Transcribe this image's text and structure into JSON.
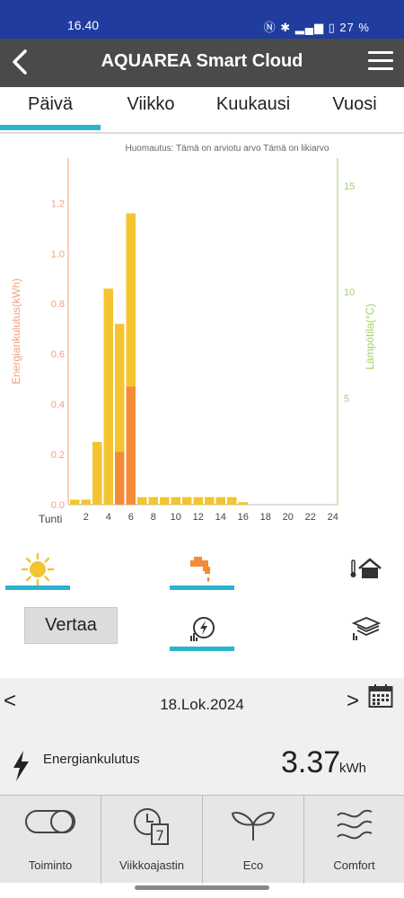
{
  "status": {
    "time": "16.40",
    "battery": "27 %"
  },
  "appbar": {
    "title": "AQUAREA Smart Cloud"
  },
  "tabs": [
    {
      "label": "Päivä"
    },
    {
      "label": "Viikko"
    },
    {
      "label": "Kuukausi"
    },
    {
      "label": "Vuosi"
    }
  ],
  "chart_data": {
    "type": "bar",
    "note": "Huomautus: Tämä on arviotu arvo Tämä on likiarvo",
    "ylabel": "Energiankulutus(kWh)",
    "y2label": "Lämpötila(°C)",
    "xlabel": "Tunti",
    "ylim": [
      0,
      1.2
    ],
    "y2lim": [
      0,
      15
    ],
    "yticks": [
      "0.0",
      "0.2",
      "0.4",
      "0.6",
      "0.8",
      "1.0",
      "1.2"
    ],
    "y2ticks": [
      "5",
      "10",
      "15"
    ],
    "xticks": [
      "2",
      "4",
      "6",
      "8",
      "10",
      "12",
      "14",
      "16",
      "18",
      "20",
      "22",
      "24"
    ],
    "categories": [
      1,
      2,
      3,
      4,
      5,
      6,
      7,
      8,
      9,
      10,
      11,
      12,
      13,
      14,
      15,
      16,
      17,
      18,
      19,
      20,
      21,
      22,
      23,
      24
    ],
    "series": [
      {
        "values": [
          0.02,
          0.02,
          0.25,
          0.86,
          0.72,
          1.16,
          0.03,
          0.03,
          0.03,
          0.03,
          0.03,
          0.03,
          0.03,
          0.03,
          0.03,
          0.01,
          0,
          0,
          0,
          0,
          0,
          0,
          0,
          0
        ]
      },
      {
        "values": [
          0,
          0,
          0,
          0,
          0.21,
          0.47,
          0,
          0,
          0,
          0,
          0,
          0,
          0,
          0,
          0,
          0,
          0,
          0,
          0,
          0,
          0,
          0,
          0,
          0
        ]
      }
    ],
    "colors": {
      "total": "#f4c430",
      "part": "#f28c38",
      "yaxis": "#f2a07b",
      "y2axis": "#a6cf6c"
    }
  },
  "modes": {
    "compare": "Vertaa"
  },
  "date": {
    "value": "18.Lok.2024"
  },
  "energy": {
    "label": "Energiankulutus",
    "value": "3.37",
    "unit": "kWh"
  },
  "nav": [
    {
      "label": "Toiminto"
    },
    {
      "label": "Viikkoajastin"
    },
    {
      "label": "Eco"
    },
    {
      "label": "Comfort"
    }
  ]
}
